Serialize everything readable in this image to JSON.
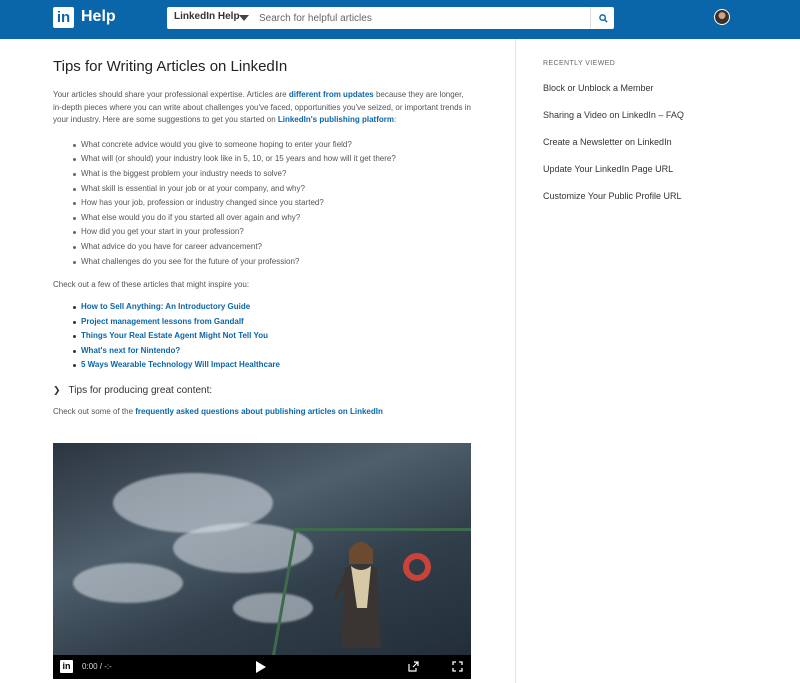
{
  "header": {
    "logo_text": "in",
    "brand": "Help",
    "search": {
      "scope": "LinkedIn Help",
      "placeholder": "Search for helpful articles"
    }
  },
  "article": {
    "title": "Tips for Writing Articles on LinkedIn",
    "intro": {
      "part1": "Your articles should share your professional expertise. Articles are ",
      "link1": "different from updates",
      "part2": " because they are longer, in-depth pieces where you can write about challenges you've faced, opportunities you've seized, or important trends in your industry. Here are some suggestions to get you started on ",
      "link2": "LinkedIn's publishing platform",
      "part3": ":"
    },
    "questions": [
      "What concrete advice would you give to someone hoping to enter your field?",
      "What will (or should) your industry look like in 5, 10, or 15 years and how will it get there?",
      "What is the biggest problem your industry needs to solve?",
      "What skill is essential in your job or at your company, and why?",
      "How has your job, profession or industry changed since you started?",
      "What else would you do if you started all over again and why?",
      "How did you get your start in your profession?",
      "What advice do you have for career advancement?",
      "What challenges do you see for the future of your profession?"
    ],
    "inspire_text": "Check out a few of these articles that might inspire you:",
    "inspire_links": [
      "How to Sell Anything: An Introductory Guide",
      "Project management lessons from Gandalf",
      "Things Your Real Estate Agent Might Not Tell You",
      "What's next for Nintendo?",
      "5 Ways Wearable Technology Will Impact Healthcare"
    ],
    "tips_toggle": "Tips for producing great content:",
    "faq": {
      "prefix": "Check out some of the ",
      "link": "frequently asked questions about publishing articles on LinkedIn"
    },
    "video": {
      "logo": "in",
      "time": "0:00 / -:-"
    }
  },
  "sidebar": {
    "heading": "RECENTLY VIEWED",
    "items": [
      "Block or Unblock a Member",
      "Sharing a Video on LinkedIn – FAQ",
      "Create a Newsletter on LinkedIn",
      "Update Your LinkedIn Page URL",
      "Customize Your Public Profile URL"
    ]
  }
}
